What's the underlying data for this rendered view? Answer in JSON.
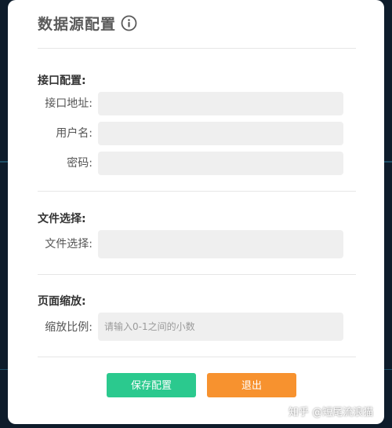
{
  "dialog": {
    "title": "数据源配置",
    "info_icon": "info-circle-icon"
  },
  "sections": {
    "api": {
      "heading": "接口配置:",
      "address_label": "接口地址:",
      "address_value": "",
      "username_label": "用户名:",
      "username_value": "",
      "password_label": "密码:",
      "password_value": ""
    },
    "file": {
      "heading": "文件选择:",
      "file_label": "文件选择:",
      "file_value": ""
    },
    "zoom": {
      "heading": "页面缩放:",
      "ratio_label": "缩放比例:",
      "ratio_placeholder": "请输入0-1之间的小数",
      "ratio_value": ""
    }
  },
  "buttons": {
    "save": "保存配置",
    "exit": "退出"
  },
  "watermark": "知乎 @短尾流浪猫",
  "colors": {
    "save_button": "#2bc98e",
    "exit_button": "#f7922f",
    "backdrop": "#0e1c2b"
  }
}
